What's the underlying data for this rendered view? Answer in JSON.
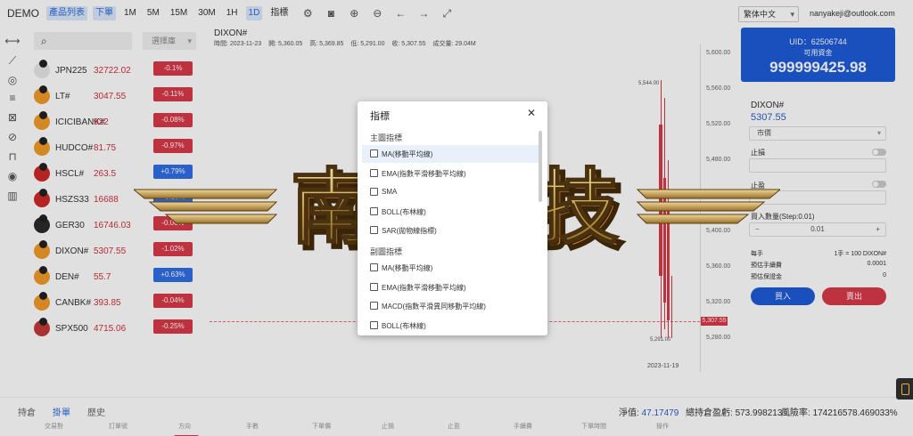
{
  "topbar": {
    "brand": "DEMO",
    "product_list": "產品列表",
    "place_order": "下單",
    "timeframes": [
      "1M",
      "5M",
      "15M",
      "30M",
      "1H",
      "1D"
    ],
    "active_timeframe": "1D",
    "indicators": "指標",
    "language": "繁体中文",
    "email": "nanyakeji@outlook.com"
  },
  "symlist": {
    "filter": "選擇庫",
    "items": [
      {
        "name": "JPN225",
        "price": "32722.02",
        "change": "-0.1%",
        "dir": "neg",
        "flag": "#e8e8e8"
      },
      {
        "name": "LT#",
        "price": "3047.55",
        "change": "-0.11%",
        "dir": "neg",
        "flag": "#f29b2a"
      },
      {
        "name": "ICICIBANK#",
        "price": "922",
        "change": "-0.08%",
        "dir": "neg",
        "flag": "#f29b2a"
      },
      {
        "name": "HUDCO#",
        "price": "81.75",
        "change": "-0.97%",
        "dir": "neg",
        "flag": "#f29b2a"
      },
      {
        "name": "HSCL#",
        "price": "263.5",
        "change": "+0.79%",
        "dir": "pos",
        "flag": "#d02828"
      },
      {
        "name": "HSZS33",
        "price": "16688",
        "change": "+0.13%",
        "dir": "pos",
        "flag": "#d02828"
      },
      {
        "name": "GER30",
        "price": "16746.03",
        "change": "-0.06%",
        "dir": "neg",
        "flag": "#2b2b2b"
      },
      {
        "name": "DIXON#",
        "price": "5307.55",
        "change": "-1.02%",
        "dir": "neg",
        "flag": "#f29b2a"
      },
      {
        "name": "DEN#",
        "price": "55.7",
        "change": "+0.63%",
        "dir": "pos",
        "flag": "#f29b2a"
      },
      {
        "name": "CANBK#",
        "price": "393.85",
        "change": "-0.04%",
        "dir": "neg",
        "flag": "#f29b2a"
      },
      {
        "name": "SPX500",
        "price": "4715.06",
        "change": "-0.25%",
        "dir": "neg",
        "flag": "#c23a3a"
      }
    ]
  },
  "chart": {
    "symbol": "DIXON#",
    "time": "時間: 2023-11-23",
    "open": "開: 5,360.05",
    "high": "高: 5,369.85",
    "low": "低: 5,291.00",
    "close": "收: 5,307.55",
    "volume": "成交量: 29.04M",
    "yticks": [
      "5,600.00",
      "5,560.00",
      "5,520.00",
      "5,480.00",
      "5,440.00",
      "5,400.00",
      "5,360.00",
      "5,320.00",
      "5,280.00"
    ],
    "current_price": "5,307.55",
    "high_label": "5,544.00",
    "low_label": "5,291.00",
    "date": "2023-11-19"
  },
  "panel": {
    "uid": "UID：62506744",
    "available_label": "可用資金",
    "available_value": "999999425.98",
    "symbol": "DIXON#",
    "price": "5307.55",
    "order_type": "市價",
    "stop_loss": "止損",
    "take_profit": "止盈",
    "qty_label": "買入數量(Step:0.01)",
    "qty_value": "0.01",
    "qty_minus": "−",
    "qty_plus": "+",
    "per_lot_label": "每手",
    "per_lot_value": "1手 = 100 DIXON#",
    "fee_label": "預估手續費",
    "fee_value": "0.0001",
    "margin_label": "預估保證金",
    "margin_value": "0",
    "buy": "買入",
    "sell": "賣出"
  },
  "bottom": {
    "tabs": [
      "持倉",
      "掛單",
      "歷史"
    ],
    "active_tab": "掛單",
    "net_label": "淨值:",
    "net_value": "47.17479",
    "pnl_label": "總持倉盈虧:",
    "pnl_value": "573.998213",
    "risk_label": "風險率:",
    "risk_value": "174216578.469033%",
    "columns": [
      "交易對",
      "訂單號",
      "方向",
      "手數",
      "下單價",
      "止損",
      "止盈",
      "手續費",
      "下單時間",
      "操作"
    ]
  },
  "watermark": {
    "text": "南亚科技"
  },
  "modal": {
    "title": "指標",
    "close": "✕",
    "main_section": "主圖指標",
    "main_items": [
      "MA(移動平均線)",
      "EMA(指數平滑移動平均線)",
      "SMA",
      "BOLL(布林線)",
      "SAR(拋物線指標)"
    ],
    "sub_section": "副圖指標",
    "sub_items": [
      "MA(移動平均線)",
      "EMA(指數平滑移動平均線)",
      "MACD(指數平滑異同移動平均線)",
      "BOLL(布林線)"
    ]
  },
  "colors": {
    "accent": "#1e5cd8",
    "down": "#d93848",
    "up": "#2f6ee5"
  }
}
